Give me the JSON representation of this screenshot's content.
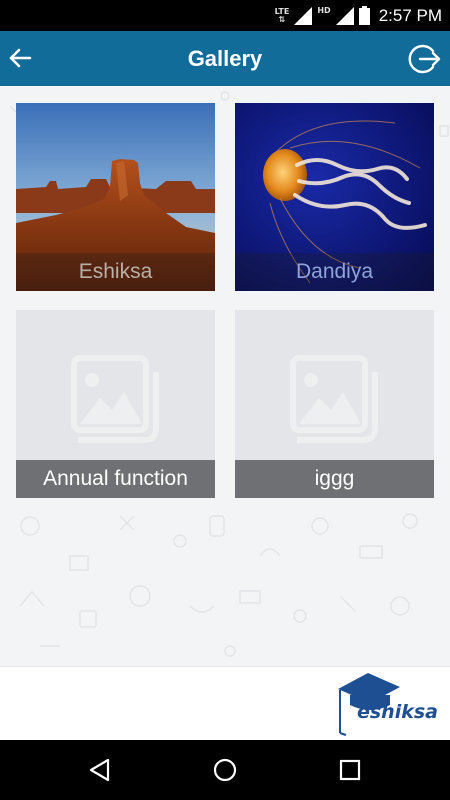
{
  "status_bar": {
    "network_label": "LTE",
    "hd_label": "HD",
    "time": "2:57 PM",
    "icons": [
      "lte-data-icon",
      "signal-icon",
      "signal-hd-icon",
      "battery-icon"
    ]
  },
  "app_bar": {
    "title": "Gallery",
    "back_icon": "arrow-left-icon",
    "logout_icon": "logout-icon"
  },
  "albums": [
    {
      "name": "Eshiksa",
      "thumbnail": "desert-butte-photo",
      "caption_color": "#b9b0a8"
    },
    {
      "name": "Dandiya",
      "thumbnail": "jellyfish-photo",
      "caption_color": "#8fa3d8"
    },
    {
      "name": "Annual function",
      "thumbnail": "image-placeholder-icon"
    },
    {
      "name": "iggg",
      "thumbnail": "image-placeholder-icon"
    }
  ],
  "footer": {
    "logo_text": "eshiksa",
    "logo_icon": "graduation-cap-icon"
  },
  "nav_bar": {
    "icons": [
      "back-triangle-icon",
      "home-circle-icon",
      "recents-square-icon"
    ]
  },
  "colors": {
    "app_bar": "#116c9a",
    "placeholder_caption": "#6f7073",
    "placeholder_bg": "#e4e5e8"
  }
}
